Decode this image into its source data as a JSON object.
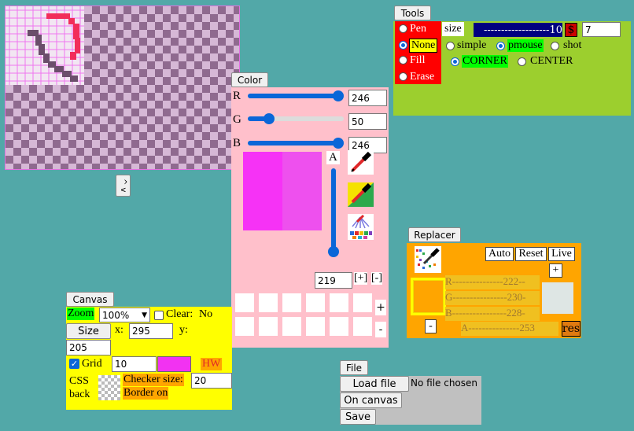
{
  "canvas_preview": {
    "toggle_label": "^ v"
  },
  "tools": {
    "header": "Tools",
    "modes": [
      "Pen",
      "None",
      "Fill",
      "Erase"
    ],
    "size_label": "size",
    "size_slider_text": "-------------------10",
    "dollar": "$",
    "size_value": "7",
    "draw_modes": [
      "simple",
      "pmouse",
      "shot"
    ],
    "anchor_modes": [
      "CORNER",
      "CENTER"
    ]
  },
  "color": {
    "header": "Color",
    "r_label": "R",
    "g_label": "G",
    "b_label": "B",
    "a_label": "A",
    "r_value": "246",
    "g_value": "50",
    "b_value": "246",
    "alpha_value": "219",
    "plus_label": "[+]",
    "minus_label": "[-]",
    "side_plus": "+",
    "side_minus": "-",
    "swatch_color": "#f632f6",
    "palette_count": 14
  },
  "replacer": {
    "header": "Replacer",
    "auto": "Auto",
    "reset": "Reset",
    "live": "Live",
    "plus": "+",
    "minus": "-",
    "r_text": "R---------------222--",
    "g_text": "G----------------230-",
    "b_text": "B----------------228-",
    "a_text": "A---------------253",
    "res": "res",
    "source_color": "#ffa500",
    "target_color": "#dee6e4"
  },
  "canvas": {
    "header": "Canvas",
    "zoom_label": "Zoom",
    "zoom_value": "100%",
    "clear_label": "Clear:",
    "clear_value": "No",
    "size_button": "Size",
    "x_label": "x:",
    "x_value": "295",
    "y_label": "y:",
    "y_value": "205",
    "grid_label": "Grid",
    "grid_value": "10",
    "grid_color": "#f232f2",
    "hw": "HW",
    "css_back": "CSS back",
    "checker_label": "Checker size:",
    "checker_value": "20",
    "border_on": "Border on"
  },
  "file": {
    "header": "File",
    "load": "Load file",
    "no_file": "No file chosen",
    "on_canvas": "On canvas",
    "save": "Save"
  },
  "colors": {
    "background": "#52a8a8",
    "tools_bg": "#9ccf2e",
    "red": "#ff0000",
    "pink_panel": "#ffc0cb",
    "orange": "#ffa500",
    "yellow": "#ffff00",
    "green_label": "#00ff00",
    "navy": "#000080"
  }
}
